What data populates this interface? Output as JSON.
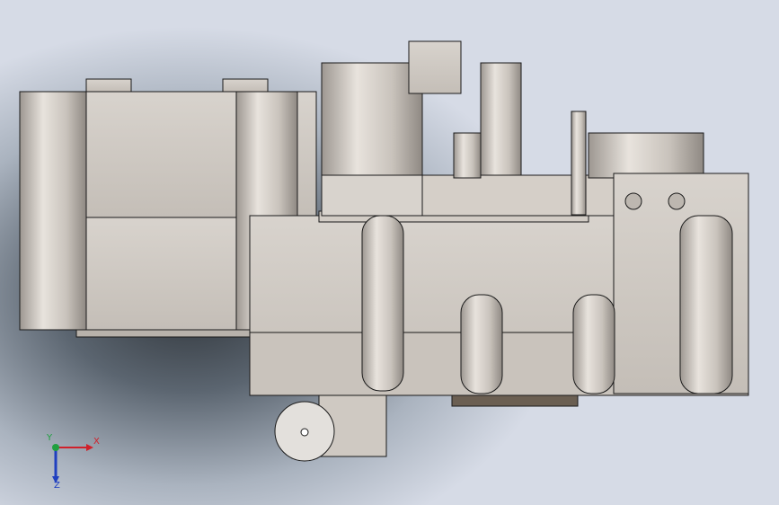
{
  "viewport": {
    "name": "3d-model-viewport",
    "background_colors": [
      "#2e3338",
      "#aab3bf",
      "#dfe3ec"
    ]
  },
  "model": {
    "part_color": "#cfc9c2",
    "shadow_color": "#8f8983",
    "edge_color": "#1a1a1a",
    "accent_color": "#6b5f52"
  },
  "triad": {
    "x_label": "X",
    "y_label": "Y",
    "z_label": "Z",
    "x_color": "#d0202a",
    "y_color": "#20a040",
    "z_color": "#2040c0"
  }
}
